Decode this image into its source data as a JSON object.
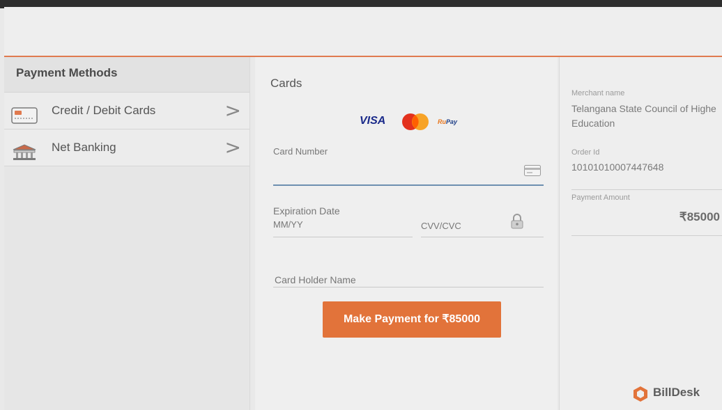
{
  "left_panel": {
    "title": "Payment Methods",
    "items": [
      {
        "label": "Credit / Debit Cards",
        "icon": "credit-card-icon",
        "chevron": ">"
      },
      {
        "label": "Net Banking",
        "icon": "bank-icon",
        "chevron": ">"
      }
    ]
  },
  "cards_form": {
    "title": "Cards",
    "brands": {
      "visa": "VISA",
      "rupay_ru": "Ru",
      "rupay_pay": "Pay"
    },
    "card_number_label": "Card Number",
    "expiration_label": "Expiration Date",
    "expiration_placeholder": "MM/YY",
    "cvv_placeholder": "CVV/CVC",
    "card_holder_placeholder": "Card Holder Name",
    "pay_button": "Make Payment for ₹85000"
  },
  "summary": {
    "merchant_label": "Merchant name",
    "merchant_line1": "Telangana State Council of Highe",
    "merchant_line2": "Education",
    "order_label": "Order Id",
    "order_value": "10101010007447648",
    "amount_label": "Payment Amount",
    "amount_value": "₹85000",
    "brand": "BillDesk"
  },
  "colors": {
    "accent_orange": "#e2733a",
    "header_border": "#e07a4f",
    "active_field": "#6d8fb0"
  }
}
